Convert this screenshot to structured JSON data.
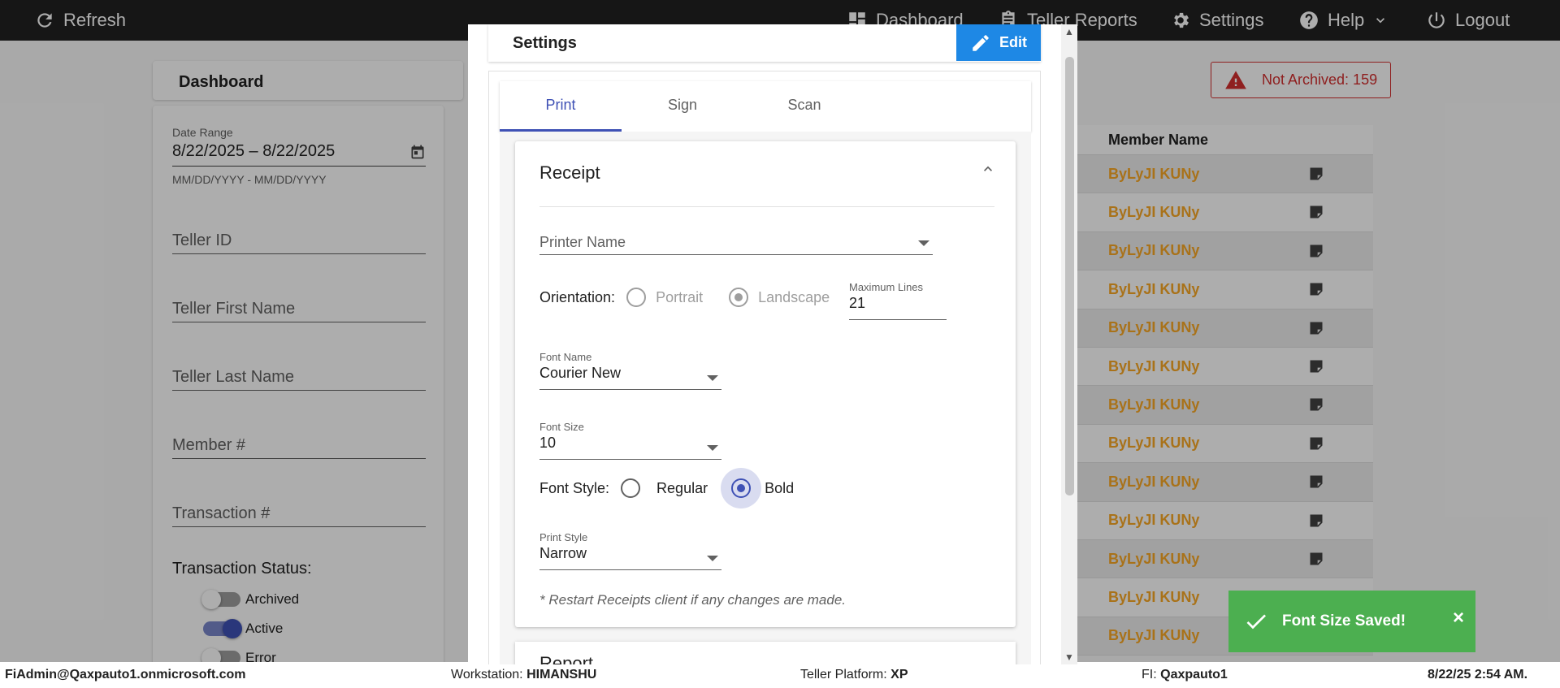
{
  "topbar": {
    "refresh": "Refresh",
    "dashboard": "Dashboard",
    "teller_reports": "Teller Reports",
    "settings": "Settings",
    "help": "Help",
    "logout": "Logout"
  },
  "dashboard": {
    "title": "Dashboard",
    "date_range_label": "Date Range",
    "date_range_value": "8/22/2025 – 8/22/2025",
    "date_range_hint": "MM/DD/YYYY - MM/DD/YYYY",
    "teller_id": "Teller ID",
    "teller_first_name": "Teller First Name",
    "teller_last_name": "Teller Last Name",
    "member_no": "Member #",
    "transaction_no": "Transaction #",
    "status_title": "Transaction Status:",
    "statuses": [
      {
        "label": "Archived",
        "on": false
      },
      {
        "label": "Active",
        "on": true
      },
      {
        "label": "Error",
        "on": false
      }
    ]
  },
  "not_archived": "Not Archived: 159",
  "table": {
    "header": "Member Name",
    "rows": [
      "ByLyJI KUNy",
      "ByLyJI KUNy",
      "ByLyJI KUNy",
      "ByLyJI KUNy",
      "ByLyJI KUNy",
      "ByLyJI KUNy",
      "ByLyJI KUNy",
      "ByLyJI KUNy",
      "ByLyJI KUNy",
      "ByLyJI KUNy",
      "ByLyJI KUNy",
      "ByLyJI KUNy",
      "ByLyJI KUNy"
    ]
  },
  "modal": {
    "title": "Settings",
    "edit": "Edit",
    "tabs": [
      "Print",
      "Sign",
      "Scan"
    ],
    "receipt": {
      "title": "Receipt",
      "printer_name": "Printer Name",
      "orientation_label": "Orientation:",
      "portrait": "Portrait",
      "landscape": "Landscape",
      "max_lines_label": "Maximum Lines",
      "max_lines_value": "21",
      "font_name_label": "Font Name",
      "font_name_value": "Courier New",
      "font_size_label": "Font Size",
      "font_size_value": "10",
      "font_style_label": "Font Style:",
      "regular": "Regular",
      "bold": "Bold",
      "print_style_label": "Print Style",
      "print_style_value": "Narrow",
      "note": "* Restart Receipts client if any changes are made."
    },
    "report_title": "Report"
  },
  "toast": {
    "message": "Font Size Saved!",
    "close": "×"
  },
  "status_bar": {
    "user": "FiAdmin@Qaxpauto1.onmicrosoft.com",
    "workstation_label": "Workstation:",
    "workstation": "HIMANSHU",
    "platform_label": "Teller Platform:",
    "platform": "XP",
    "fi_label": "FI:",
    "fi": "Qaxpauto1",
    "datetime": "8/22/25 2:54 AM."
  }
}
